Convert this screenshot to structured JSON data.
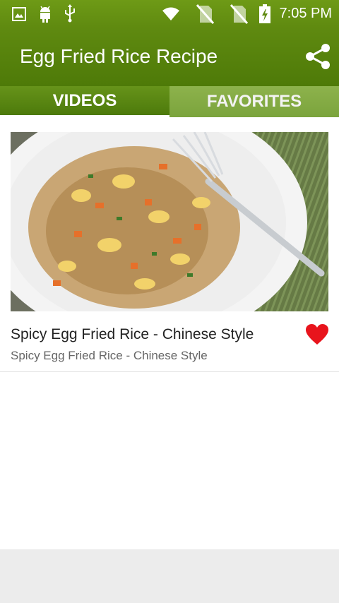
{
  "status": {
    "time": "7:05 PM",
    "icons": [
      "image-icon",
      "android-icon",
      "usb-icon",
      "wifi-icon",
      "no-sim-icon",
      "no-sim-icon",
      "battery-charging-icon"
    ]
  },
  "appbar": {
    "title": "Egg Fried Rice Recipe",
    "share_icon": "share-icon"
  },
  "tabs": [
    {
      "label": "VIDEOS",
      "active": true
    },
    {
      "label": "FAVORITES",
      "active": false
    }
  ],
  "videos": [
    {
      "title": "Spicy Egg Fried Rice - Chinese Style",
      "subtitle": "Spicy Egg Fried Rice - Chinese Style",
      "favorite": true
    }
  ],
  "colors": {
    "primary": "#5f8a10",
    "tab_inactive": "#8db24c",
    "heart": "#e8141c"
  }
}
